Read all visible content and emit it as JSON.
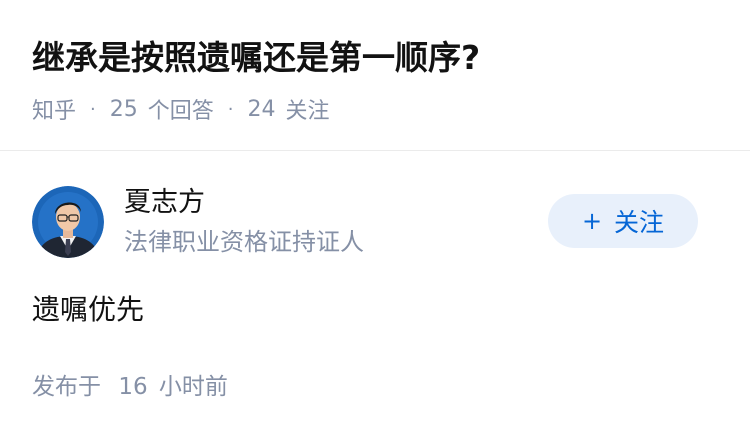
{
  "question": {
    "title": "继承是按照遗嘱还是第一顺序?",
    "source": "知乎",
    "answer_count": "25",
    "answer_label": "个回答",
    "follower_count": "24",
    "follower_label": "关注"
  },
  "author": {
    "name": "夏志方",
    "headline": "法律职业资格证持证人",
    "avatar_icon": "person-avatar"
  },
  "follow_button": {
    "icon": "plus-icon",
    "label": "关注",
    "text_color": "#0566d6",
    "background": "#e8f0fb"
  },
  "answer": {
    "content": "遗嘱优先",
    "time_prefix": "发布于",
    "time_value": "16",
    "time_unit": "小时前"
  },
  "colors": {
    "primary_text": "#121212",
    "secondary_text": "#8590a6",
    "divider": "#ebebeb"
  }
}
